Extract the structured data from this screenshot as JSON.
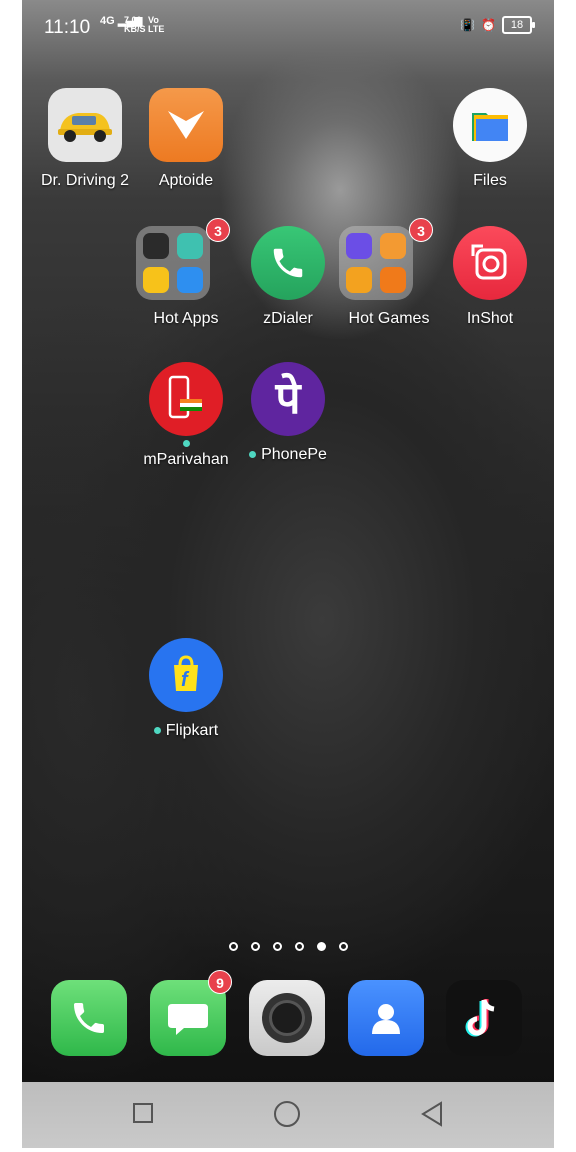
{
  "status_bar": {
    "time": "11:10",
    "signal": "4G",
    "data_rate_value": "7.00",
    "data_rate_unit": "KB/S",
    "volte_top": "Vo",
    "volte_bottom": "LTE",
    "battery": "18"
  },
  "home_apps": [
    {
      "label": "Dr. Driving 2"
    },
    {
      "label": "Aptoide"
    },
    {
      "label": "Files"
    },
    {
      "label": "Hot Apps",
      "badge": "3"
    },
    {
      "label": "zDialer"
    },
    {
      "label": "Hot Games",
      "badge": "3"
    },
    {
      "label": "InShot"
    },
    {
      "label": "mParivahan"
    },
    {
      "label": "PhonePe"
    },
    {
      "label": "Flipkart"
    }
  ],
  "page_indicator": {
    "pages": 6,
    "active": 5
  },
  "dock": {
    "messages_badge": "9",
    "apps": [
      "phone-icon",
      "messages-icon",
      "camera-icon",
      "contacts-icon",
      "tiktok-icon"
    ]
  },
  "colors": {
    "badge": "#e8414c",
    "aptoide": "#f08a32",
    "zdialer": "#2db86c",
    "inshot": "#f0384a",
    "mparivahan": "#e01e26",
    "phonepe": "#5f259f",
    "flipkart": "#2874f0",
    "contacts": "#2f7cf6"
  }
}
